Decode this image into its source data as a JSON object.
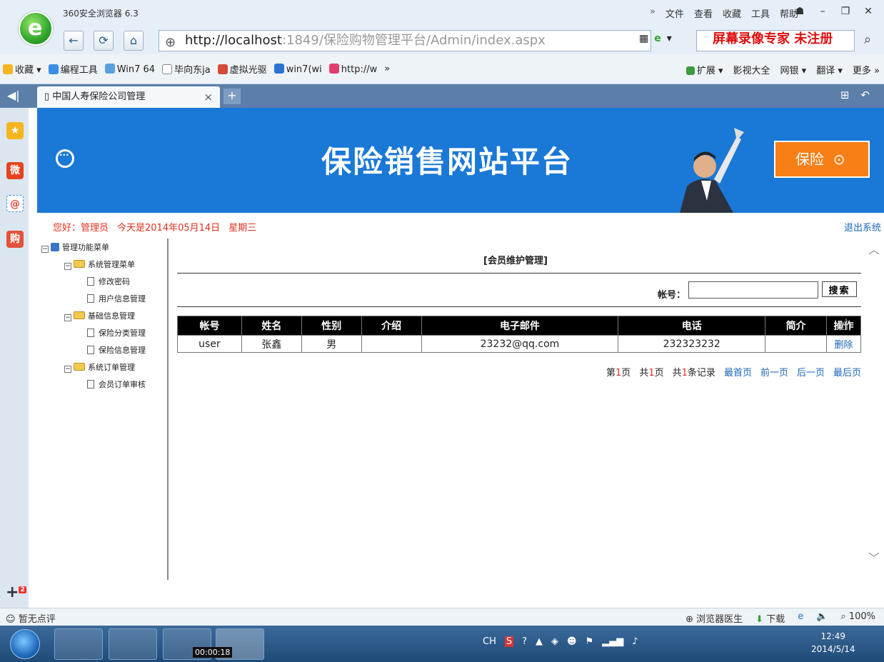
{
  "browser": {
    "app_title": "360安全浏览器 6.3",
    "menu": [
      "»",
      "文件",
      "查看",
      "收藏",
      "工具",
      "帮助"
    ],
    "address_host": "http://localhost",
    "address_rest": ":1849/保险购物管理平台/Admin/index.aspx",
    "watermark": "屏幕录像专家  未注册",
    "favorites": [
      "收藏",
      "编程工具",
      "Win7 64",
      "毕向东ja",
      "虚拟光驱",
      "win7(wi",
      "http://w",
      "»"
    ],
    "fav_right": [
      "扩展",
      "影视大全",
      "网银",
      "翻译",
      "更多 »"
    ],
    "tab_title": "中国人寿保险公司管理",
    "status_left": "暂无点评",
    "status_right": [
      "浏览器医生",
      "下载",
      "100%"
    ],
    "timer": "00:00:18",
    "clock_time": "12:49",
    "clock_date": "2014/5/14",
    "tray_lang": "CH"
  },
  "site": {
    "banner_title": "保险销售网站平台",
    "banner_button": "保险",
    "greeting_user": "您好：管理员",
    "greeting_date": "今天是2014年05月14日",
    "greeting_weekday": "星期三",
    "logout": "退出系统"
  },
  "tree": {
    "root": "管理功能菜单",
    "groups": [
      {
        "label": "系统管理菜单",
        "items": [
          "修改密码",
          "用户信息管理"
        ]
      },
      {
        "label": "基础信息管理",
        "items": [
          "保险分类管理",
          "保险信息管理"
        ]
      },
      {
        "label": "系统订单管理",
        "items": [
          "会员订单审核"
        ]
      }
    ]
  },
  "panel": {
    "title": "[会员维护管理]",
    "search_label": "帐号：",
    "search_value": "",
    "search_button": "搜索"
  },
  "table": {
    "headers": [
      "帐号",
      "姓名",
      "性别",
      "介绍",
      "电子邮件",
      "电话",
      "简介",
      "操作"
    ],
    "rows": [
      [
        "user",
        "张鑫",
        "男",
        "",
        "23232@qq.com",
        "232323232",
        "",
        "删除"
      ]
    ]
  },
  "pager": {
    "page_prefix": "第",
    "page_num": "1",
    "page_suffix": "页",
    "total_prefix": "共",
    "total_num": "1",
    "total_suffix": "页",
    "records_prefix": "共",
    "records_num": "1",
    "records_suffix": "条记录",
    "first": "最首页",
    "prev": "前一页",
    "next": "后一页",
    "last": "最后页"
  },
  "colors": {
    "banner_blue": "#1a78d6",
    "banner_orange": "#f77f15",
    "greeting_red": "#e0301e",
    "link_blue": "#1a66b8"
  }
}
